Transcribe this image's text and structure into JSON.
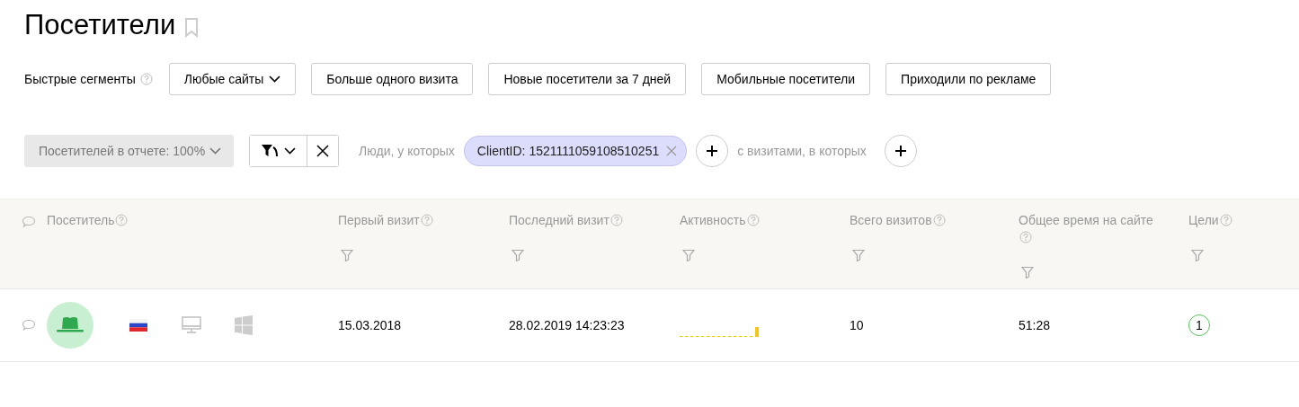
{
  "title": "Посетители",
  "quick_segments": {
    "label": "Быстрые сегменты",
    "buttons": [
      {
        "label": "Любые сайты",
        "kind": "dropdown"
      },
      {
        "label": "Больше одного визита",
        "kind": "plain"
      },
      {
        "label": "Новые посетители за 7 дней",
        "kind": "plain"
      },
      {
        "label": "Мобильные посетители",
        "kind": "plain"
      },
      {
        "label": "Приходили по рекламе",
        "kind": "plain"
      }
    ]
  },
  "filter": {
    "sample": "Посетителей в отчете: 100%",
    "people_label": "Люди, у которых",
    "condition": "ClientID: 1521111059108510251",
    "visits_label": "с визитами, в которых"
  },
  "table": {
    "columns": [
      "Посетитель",
      "Первый визит",
      "Последний визит",
      "Активность",
      "Всего визитов",
      "Общее время на сайте",
      "Цели"
    ],
    "rows": [
      {
        "first_visit": "15.03.2018",
        "last_visit": "28.02.2019 14:23:23",
        "total_visits": "10",
        "total_time": "51:28",
        "goals": "1"
      }
    ]
  }
}
